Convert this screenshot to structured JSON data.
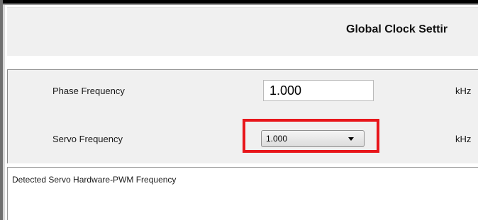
{
  "header": {
    "title": "Global Clock Settir"
  },
  "fields": {
    "phase_frequency": {
      "label": "Phase Frequency",
      "value": "1.000",
      "unit": "kHz"
    },
    "servo_frequency": {
      "label": "Servo Frequency",
      "selected": "1.000",
      "unit": "kHz"
    }
  },
  "detected_group": {
    "legend": "Detected Servo Hardware-PWM Frequency"
  },
  "colors": {
    "highlight": "#e8161b",
    "panel_bg": "#f0f0f0"
  }
}
